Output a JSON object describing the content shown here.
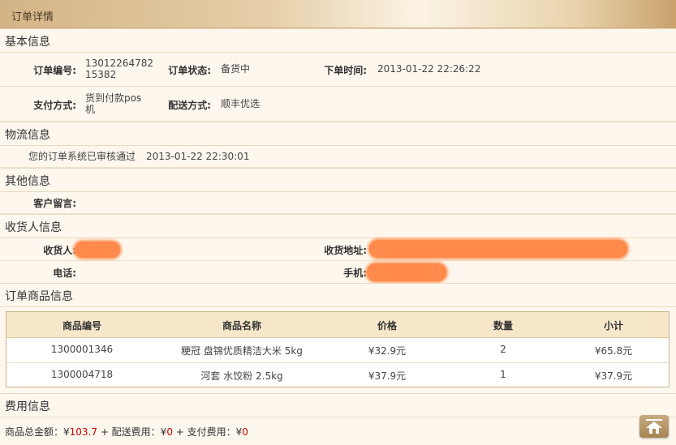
{
  "header": {
    "title": "订单详情"
  },
  "basic": {
    "section_title": "基本信息",
    "order_no_label": "订单编号:",
    "order_no_line1": "13012264782",
    "order_no_line2": "15382",
    "status_label": "订单状态:",
    "status_value": "备货中",
    "time_label": "下单时间:",
    "time_value": "2013-01-22 22:26:22",
    "pay_label": "支付方式:",
    "pay_line1": "货到付款pos",
    "pay_line2": "机",
    "ship_label": "配送方式:",
    "ship_value": "顺丰优选"
  },
  "logistics": {
    "section_title": "物流信息",
    "message": "您的订单系统已审核通过",
    "time": "2013-01-22 22:30:01"
  },
  "other": {
    "section_title": "其他信息",
    "remark_label": "客户留言:"
  },
  "receiver": {
    "section_title": "收货人信息",
    "name_label": "收货人:",
    "address_label": "收货地址:",
    "phone_label": "电话:",
    "mobile_label": "手机:"
  },
  "goods": {
    "section_title": "订单商品信息",
    "columns": [
      "商品编号",
      "商品名称",
      "价格",
      "数量",
      "小计"
    ],
    "rows": [
      {
        "id": "1300001346",
        "name": "粳冠 盘锦优质精洁大米 5kg",
        "price": "¥32.9元",
        "qty": "2",
        "subtotal": "¥65.8元"
      },
      {
        "id": "1300004718",
        "name": "河套 水饺粉 2.5kg",
        "price": "¥37.9元",
        "qty": "1",
        "subtotal": "¥37.9元"
      }
    ]
  },
  "fees": {
    "section_title": "费用信息",
    "goods_total_label": "商品总金额：¥",
    "goods_total": "103.7",
    "ship_fee_label": " + 配送费用：¥",
    "ship_fee": "0",
    "pay_fee_label": " + 支付费用：¥",
    "pay_fee": "0"
  },
  "colors": {
    "accent": "#c9a26c",
    "price_red": "#cc0000",
    "redaction": "#ff8a4c"
  }
}
